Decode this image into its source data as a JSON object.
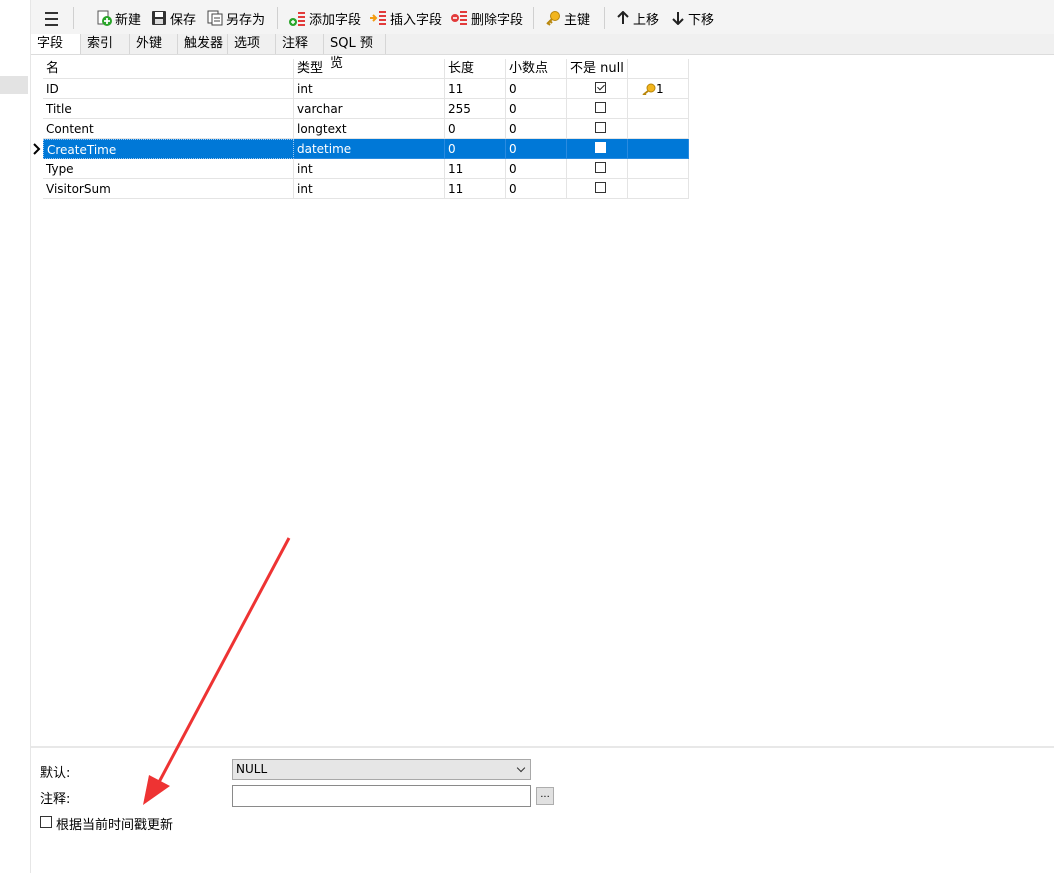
{
  "toolbar": {
    "new_label": "新建",
    "save_label": "保存",
    "save_as_label": "另存为",
    "add_field_label": "添加字段",
    "insert_field_label": "插入字段",
    "delete_field_label": "删除字段",
    "primary_key_label": "主键",
    "move_up_label": "上移",
    "move_down_label": "下移"
  },
  "tabs": [
    {
      "label": "字段",
      "active": true
    },
    {
      "label": "索引"
    },
    {
      "label": "外键"
    },
    {
      "label": "触发器"
    },
    {
      "label": "选项"
    },
    {
      "label": "注释"
    },
    {
      "label": "SQL 预览"
    }
  ],
  "grid": {
    "headers": [
      "名",
      "类型",
      "长度",
      "小数点",
      "不是 null",
      ""
    ],
    "rows": [
      {
        "name": "ID",
        "type": "int",
        "length": "11",
        "decimals": "0",
        "not_null": true,
        "key": "1"
      },
      {
        "name": "Title",
        "type": "varchar",
        "length": "255",
        "decimals": "0",
        "not_null": false,
        "key": ""
      },
      {
        "name": "Content",
        "type": "longtext",
        "length": "0",
        "decimals": "0",
        "not_null": false,
        "key": ""
      },
      {
        "name": "CreateTime",
        "type": "datetime",
        "length": "0",
        "decimals": "0",
        "not_null": false,
        "key": "",
        "selected": true
      },
      {
        "name": "Type",
        "type": "int",
        "length": "11",
        "decimals": "0",
        "not_null": false,
        "key": ""
      },
      {
        "name": "VisitorSum",
        "type": "int",
        "length": "11",
        "decimals": "0",
        "not_null": false,
        "key": ""
      }
    ]
  },
  "properties": {
    "default_label": "默认:",
    "default_value": "NULL",
    "comment_label": "注释:",
    "comment_value": "",
    "ellipsis_label": "...",
    "update_on_timestamp_label": "根据当前时间戳更新"
  },
  "colors": {
    "selection": "#0078d7",
    "annotation_arrow": "#ee3333"
  }
}
